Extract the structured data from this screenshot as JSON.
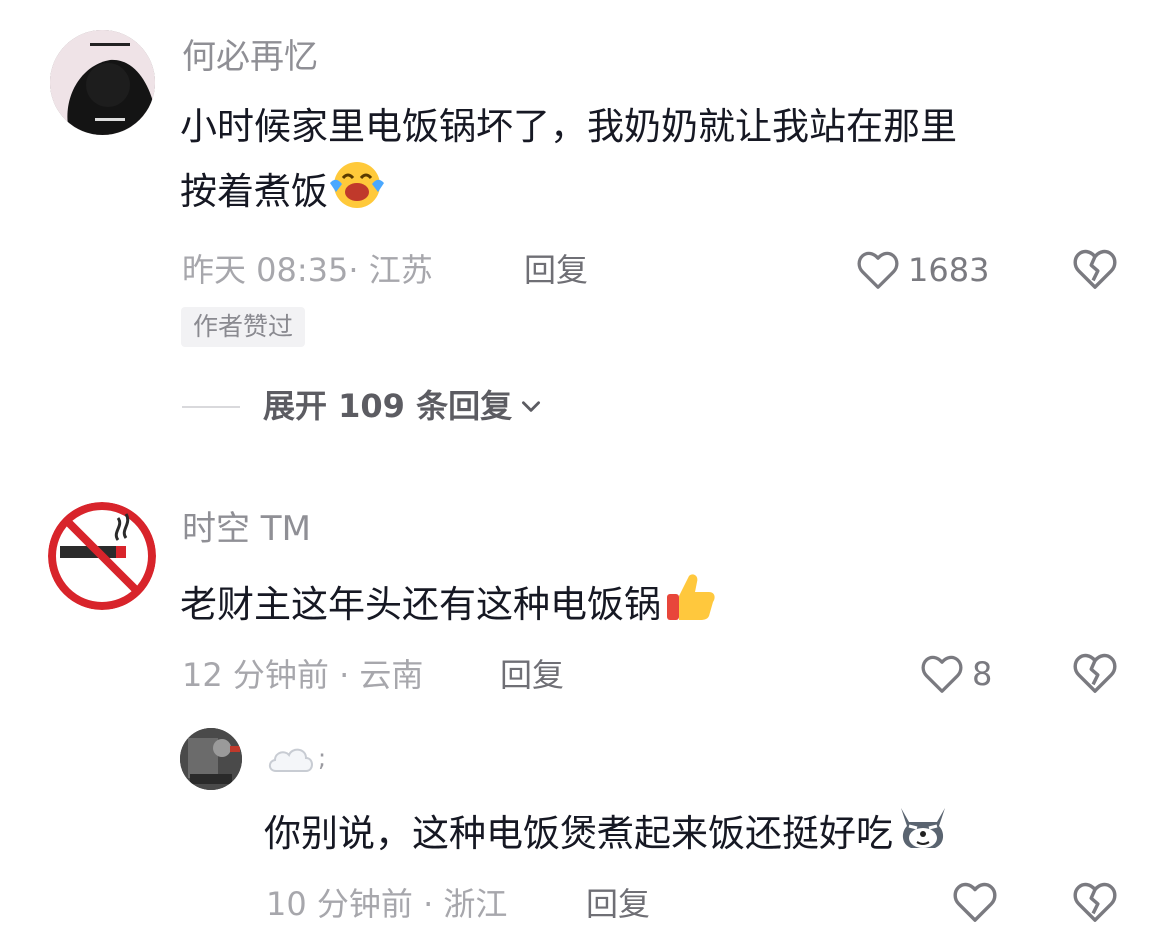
{
  "comments": [
    {
      "username": "何必再忆",
      "text_line1": "小时候家里电饭锅坏了，我奶奶就让我站在那里",
      "text_line2": "按着煮饭",
      "emoji": "crying-laughing-emoji",
      "time": "昨天 08:35",
      "location": "· 江苏",
      "reply_label": "回复",
      "likes": "1683",
      "badge": "作者赞过",
      "expand_label": "展开 109 条回复"
    },
    {
      "username": "时空 TM",
      "text": "老财主这年头还有这种电饭锅",
      "emoji": "thumbs-up-emoji",
      "time": "12 分钟前",
      "location": "· 云南",
      "reply_label": "回复",
      "likes": "8"
    }
  ],
  "reply": {
    "username": "☁️ ;",
    "text": "你别说，这种电饭煲煮起来饭还挺好吃",
    "emoji": "husky-dog-emoji",
    "time": "10 分钟前",
    "location": "· 浙江",
    "reply_label": "回复"
  },
  "icons": {
    "like": "heart-outline-icon",
    "dislike": "broken-heart-icon",
    "expand": "chevron-down-icon"
  }
}
